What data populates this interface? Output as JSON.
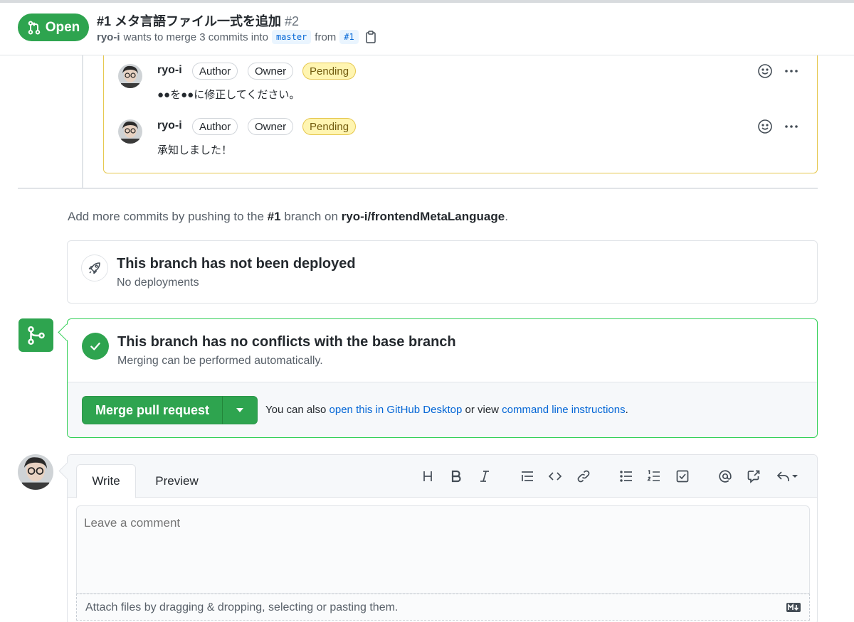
{
  "header": {
    "state": "Open",
    "title": "#1 メタ言語ファイル一式を追加",
    "number": "#2",
    "meta_author": "ryo-i",
    "meta_text": "wants to merge 3 commits into",
    "base_branch": "master",
    "from_text": "from",
    "head_branch": "#1"
  },
  "review": {
    "comments": [
      {
        "author": "ryo-i",
        "labels": [
          "Author",
          "Owner",
          "Pending"
        ],
        "body": "●●を●●に修正してください。"
      },
      {
        "author": "ryo-i",
        "labels": [
          "Author",
          "Owner",
          "Pending"
        ],
        "body": "承知しました！"
      }
    ]
  },
  "push_hint": {
    "prefix": "Add more commits by pushing to the",
    "branch": "#1",
    "middle": "branch on",
    "repo": "ryo-i/frontendMetaLanguage",
    "suffix": "."
  },
  "deploy": {
    "title": "This branch has not been deployed",
    "subtitle": "No deployments"
  },
  "merge": {
    "title": "This branch has no conflicts with the base branch",
    "subtitle": "Merging can be performed automatically.",
    "button_label": "Merge pull request",
    "hint_prefix": "You can also",
    "hint_link1": "open this in GitHub Desktop",
    "hint_middle": "or view",
    "hint_link2": "command line instructions",
    "hint_suffix": "."
  },
  "new_comment": {
    "tab_write": "Write",
    "tab_preview": "Preview",
    "placeholder": "Leave a comment",
    "attach_text": "Attach files by dragging & dropping, selecting or pasting them."
  },
  "colors": {
    "green": "#2ea44f",
    "pending_bg": "#fff5b1",
    "pending_border": "#e6c84f",
    "link": "#0366d6"
  }
}
